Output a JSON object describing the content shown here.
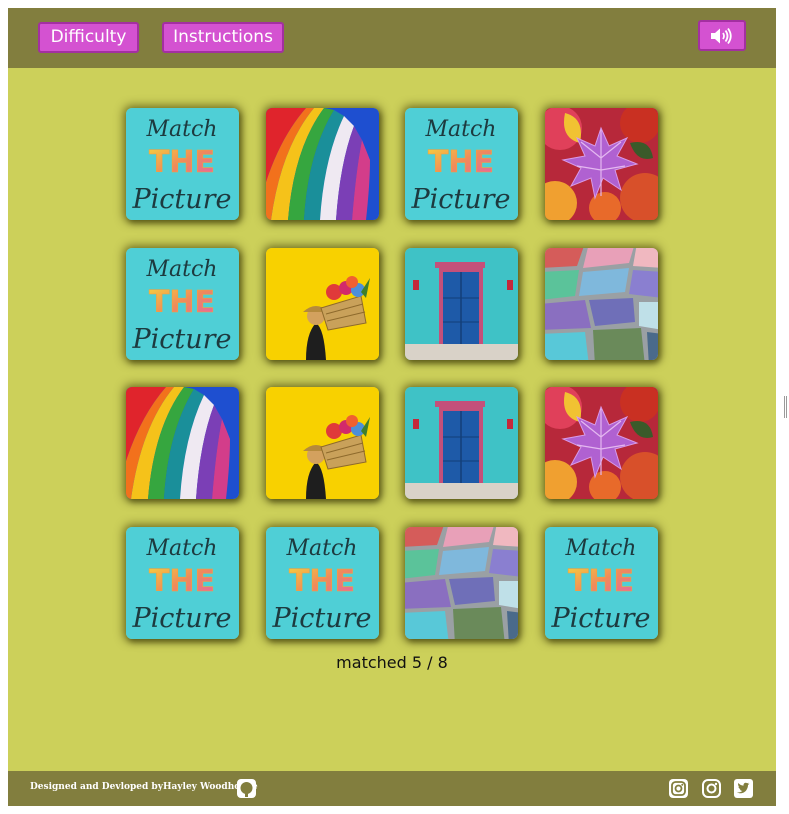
{
  "header": {
    "difficulty_label": "Difficulty",
    "instructions_label": "Instructions",
    "sound_icon": "volume-up-icon"
  },
  "board": {
    "columns": 4,
    "rows": 4,
    "cards": [
      [
        "card-back",
        "hot-air-balloon",
        "card-back",
        "autumn-leaves"
      ],
      [
        "card-back",
        "flower-basket",
        "blue-door",
        "colorful-paving"
      ],
      [
        "hot-air-balloon",
        "flower-basket",
        "blue-door",
        "autumn-leaves"
      ],
      [
        "card-back",
        "card-back",
        "colorful-paving",
        "card-back"
      ]
    ],
    "card_back_text": {
      "line1": "Match",
      "line2": "THE",
      "line3": "Picture"
    }
  },
  "status": {
    "prefix": "matched",
    "matched": "5",
    "separator": "/",
    "total": "8"
  },
  "footer": {
    "credit_prefix": "Designed and Devloped by",
    "credit_name": "Hayley Woodhouse",
    "icons": [
      "github-icon",
      "instagram-icon",
      "instagram-icon",
      "twitter-icon"
    ]
  },
  "colors": {
    "page_bg": "#ccd05a",
    "bar_bg": "#827e3e",
    "button_bg": "#d452d1",
    "card_back_bg": "#4fcfd6"
  }
}
